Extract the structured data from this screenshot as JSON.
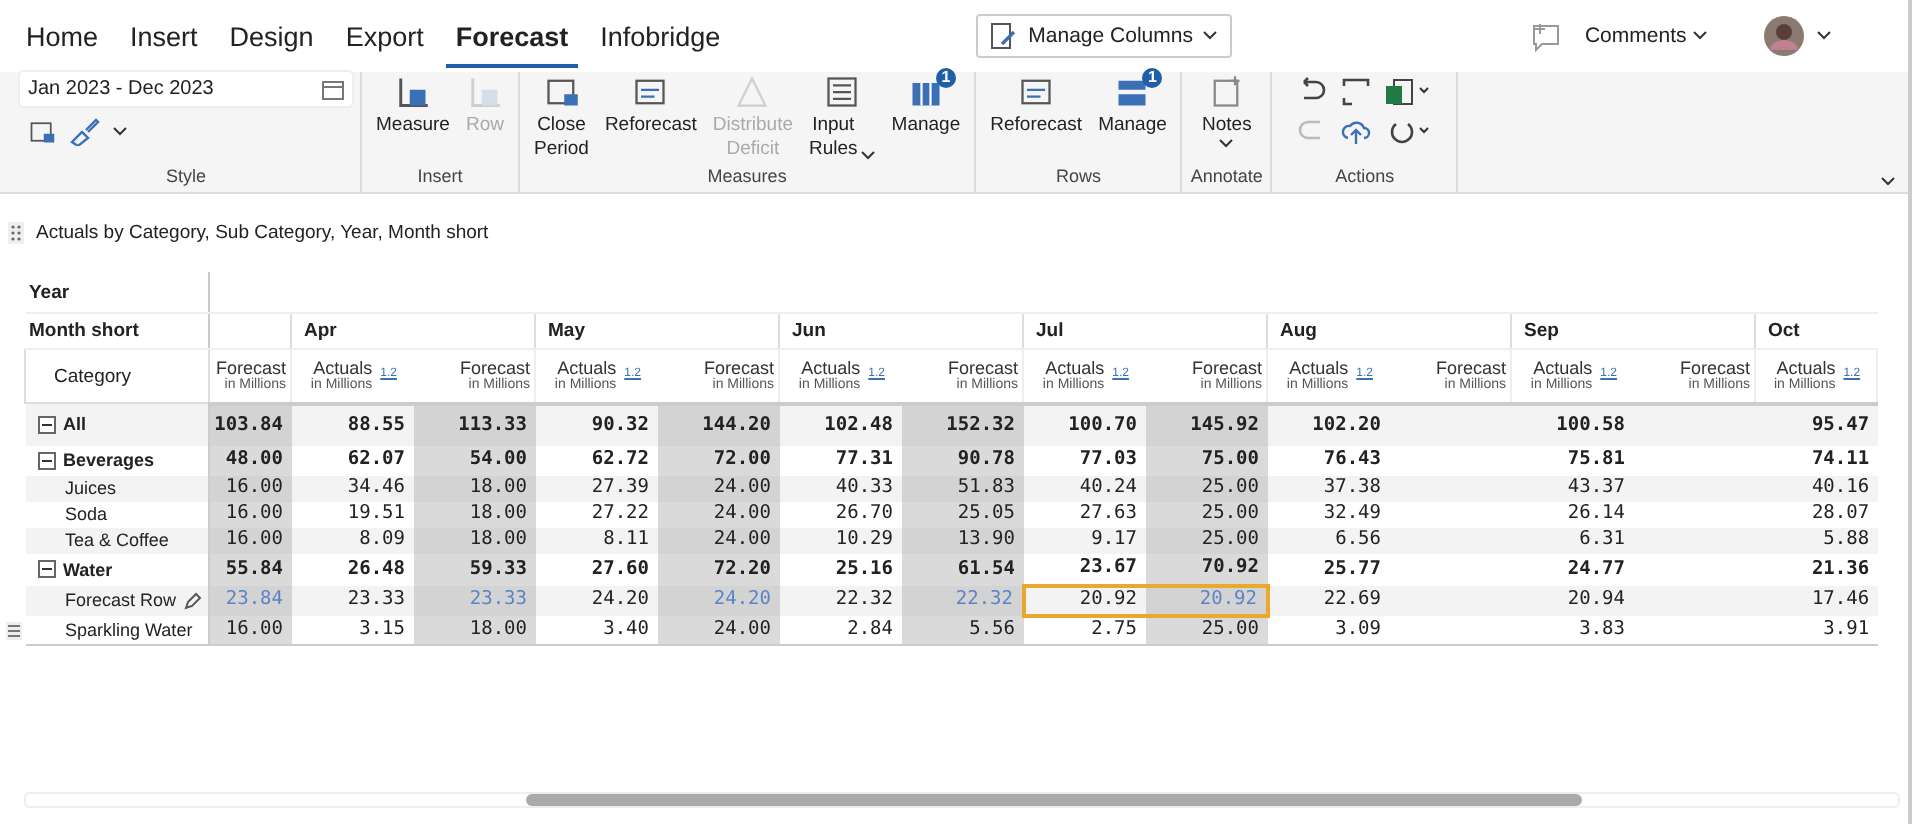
{
  "tabs": [
    {
      "label": "Home",
      "selected": false
    },
    {
      "label": "Insert",
      "selected": false
    },
    {
      "label": "Design",
      "selected": false
    },
    {
      "label": "Export",
      "selected": false
    },
    {
      "label": "Forecast",
      "selected": true
    },
    {
      "label": "Infobridge",
      "selected": false
    }
  ],
  "manage_columns": {
    "label": "Manage Columns"
  },
  "comments": {
    "label": "Comments"
  },
  "ribbon": {
    "date_range": "Jan 2023 - Dec 2023",
    "groups": [
      {
        "label": "Style",
        "kind": "style"
      },
      {
        "label": "Insert",
        "kind": "buttons",
        "items": [
          {
            "label": "Measure",
            "disabled": false
          },
          {
            "label": "Row",
            "disabled": true
          }
        ]
      },
      {
        "label": "Measures",
        "kind": "buttons",
        "items": [
          {
            "label": "Close Period",
            "disabled": false
          },
          {
            "label": "Reforecast",
            "disabled": false
          },
          {
            "label": "Distribute Deficit",
            "disabled": true
          },
          {
            "label": "Input Rules",
            "disabled": false,
            "dropdown": true
          },
          {
            "label": "Manage",
            "disabled": false,
            "badge": "1"
          }
        ]
      },
      {
        "label": "Rows",
        "kind": "buttons",
        "items": [
          {
            "label": "Reforecast",
            "disabled": false
          },
          {
            "label": "Manage",
            "disabled": false,
            "badge": "1"
          }
        ]
      },
      {
        "label": "Annotate",
        "kind": "buttons",
        "items": [
          {
            "label": "Notes",
            "disabled": false,
            "dropdown": true
          }
        ]
      },
      {
        "label": "Actions",
        "kind": "actions"
      }
    ]
  },
  "caption": "Actuals by Category, Sub Category, Year, Month short",
  "table": {
    "year_label": "Year",
    "month_label": "Month short",
    "category_label": "Category",
    "months": [
      {
        "columns": [
          {
            "measure": "Forecast",
            "unit": "in Millions",
            "shaded": true,
            "has_values": true
          }
        ]
      },
      {
        "name": "Apr",
        "columns": [
          {
            "measure": "Actuals",
            "unit": "in Millions",
            "sort_mark": "1.2",
            "shaded": false,
            "has_values": true
          },
          {
            "measure": "Forecast",
            "unit": "in Millions",
            "shaded": true,
            "has_values": true
          }
        ]
      },
      {
        "name": "May",
        "columns": [
          {
            "measure": "Actuals",
            "unit": "in Millions",
            "sort_mark": "1.2",
            "shaded": false,
            "has_values": true
          },
          {
            "measure": "Forecast",
            "unit": "in Millions",
            "shaded": true,
            "has_values": true
          }
        ]
      },
      {
        "name": "Jun",
        "columns": [
          {
            "measure": "Actuals",
            "unit": "in Millions",
            "sort_mark": "1.2",
            "shaded": false,
            "has_values": true
          },
          {
            "measure": "Forecast",
            "unit": "in Millions",
            "shaded": true,
            "has_values": true
          }
        ]
      },
      {
        "name": "Jul",
        "columns": [
          {
            "measure": "Actuals",
            "unit": "in Millions",
            "sort_mark": "1.2",
            "shaded": false,
            "has_values": true
          },
          {
            "measure": "Forecast",
            "unit": "in Millions",
            "shaded": true,
            "has_values": true
          }
        ]
      },
      {
        "name": "Aug",
        "columns": [
          {
            "measure": "Actuals",
            "unit": "in Millions",
            "sort_mark": "1.2",
            "shaded": false,
            "has_values": true
          },
          {
            "measure": "Forecast",
            "unit": "in Millions",
            "shaded": false,
            "has_values": false
          }
        ]
      },
      {
        "name": "Sep",
        "columns": [
          {
            "measure": "Actuals",
            "unit": "in Millions",
            "sort_mark": "1.2",
            "shaded": false,
            "has_values": true
          },
          {
            "measure": "Forecast",
            "unit": "in Millions",
            "shaded": false,
            "has_values": false
          }
        ]
      },
      {
        "name": "Oct",
        "columns": [
          {
            "measure": "Actuals",
            "unit": "in Millions",
            "sort_mark": "1.2",
            "shaded": false,
            "has_values": true
          }
        ]
      }
    ],
    "rows": [
      {
        "label": "All",
        "kind": "group",
        "expanded": true,
        "values": [
          "103.84",
          "88.55",
          "113.33",
          "90.32",
          "144.20",
          "102.48",
          "152.32",
          "100.70",
          "145.92",
          "102.20",
          "100.58",
          "95.47"
        ],
        "children": [
          {
            "label": "Beverages",
            "kind": "group",
            "expanded": true,
            "values": [
              "48.00",
              "62.07",
              "54.00",
              "62.72",
              "72.00",
              "77.31",
              "90.78",
              "77.03",
              "75.00",
              "76.43",
              "75.81",
              "74.11"
            ],
            "children": [
              {
                "label": "Juices",
                "kind": "item",
                "values": [
                  "16.00",
                  "34.46",
                  "18.00",
                  "27.39",
                  "24.00",
                  "40.33",
                  "51.83",
                  "40.24",
                  "25.00",
                  "37.38",
                  "43.37",
                  "40.16"
                ]
              },
              {
                "label": "Soda",
                "kind": "item",
                "values": [
                  "16.00",
                  "19.51",
                  "18.00",
                  "27.22",
                  "24.00",
                  "26.70",
                  "25.05",
                  "27.63",
                  "25.00",
                  "32.49",
                  "26.14",
                  "28.07"
                ]
              },
              {
                "label": "Tea & Coffee",
                "kind": "item",
                "values": [
                  "16.00",
                  "8.09",
                  "18.00",
                  "8.11",
                  "24.00",
                  "10.29",
                  "13.90",
                  "9.17",
                  "25.00",
                  "6.56",
                  "6.31",
                  "5.88"
                ]
              }
            ]
          },
          {
            "label": "Water",
            "kind": "group",
            "expanded": true,
            "values": [
              "55.84",
              "26.48",
              "59.33",
              "27.60",
              "72.20",
              "25.16",
              "61.54",
              "23.67",
              "70.92",
              "25.77",
              "24.77",
              "21.36"
            ],
            "children": [
              {
                "label": "Forecast Row",
                "kind": "item",
                "editable": true,
                "cells": [
                  {
                    "value": "23.84",
                    "highlighted": false
                  },
                  {
                    "value": "23.33",
                    "highlighted": false
                  },
                  {
                    "value": "23.33",
                    "highlighted": false
                  },
                  {
                    "value": "24.20",
                    "highlighted": false
                  },
                  {
                    "value": "24.20",
                    "highlighted": false
                  },
                  {
                    "value": "22.32",
                    "highlighted": false
                  },
                  {
                    "value": "22.32",
                    "highlighted": false
                  },
                  {
                    "value": "20.92",
                    "highlighted": true
                  },
                  {
                    "value": "20.92",
                    "highlighted": true
                  },
                  {
                    "value": "22.69",
                    "highlighted": false
                  },
                  {
                    "value": "20.94",
                    "highlighted": false
                  },
                  {
                    "value": "17.46",
                    "highlighted": false
                  }
                ]
              },
              {
                "label": "Sparkling Water",
                "kind": "item",
                "values": [
                  "16.00",
                  "3.15",
                  "18.00",
                  "3.40",
                  "24.00",
                  "2.84",
                  "5.56",
                  "2.75",
                  "25.00",
                  "3.09",
                  "3.83",
                  "3.91"
                ]
              }
            ]
          }
        ]
      }
    ]
  }
}
